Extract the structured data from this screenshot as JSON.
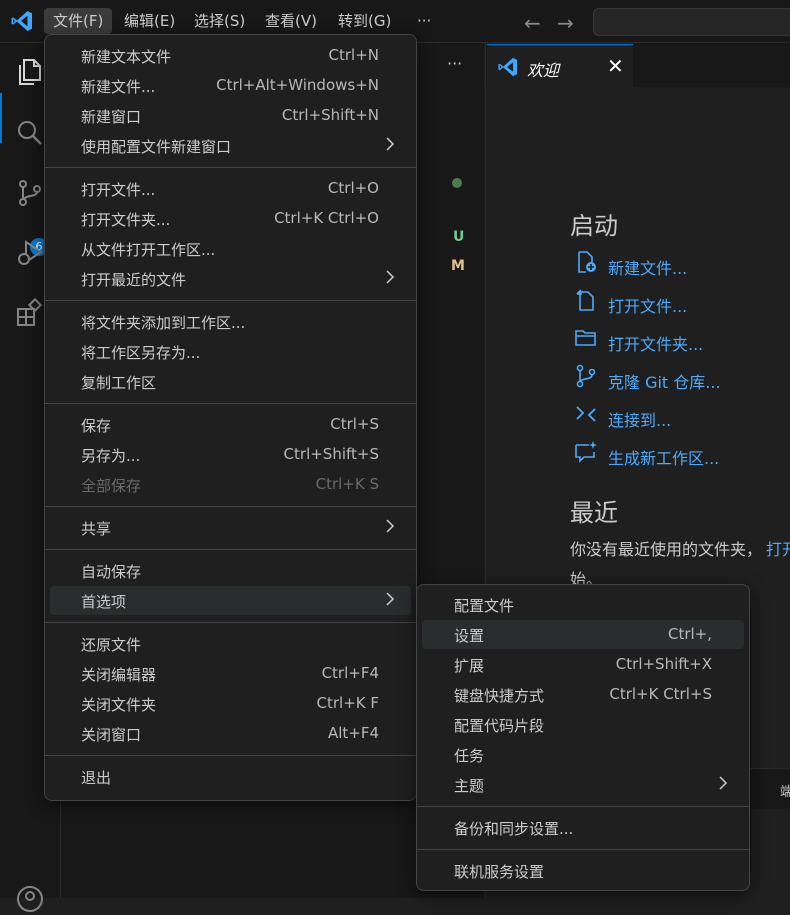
{
  "titlebar": {
    "menus": [
      "文件(F)",
      "编辑(E)",
      "选择(S)",
      "查看(V)",
      "转到(G)",
      "···"
    ],
    "back_arrow": "←",
    "forward_arrow": "→"
  },
  "activity_bar": {
    "icons": [
      "explorer-icon",
      "search-icon",
      "source-control-icon",
      "run-debug-icon",
      "extensions-icon",
      "account-icon"
    ],
    "scm_badge": "6"
  },
  "sidebar": {
    "more": "···",
    "status_u": "U",
    "status_m": "M"
  },
  "tab": {
    "label": "欢迎",
    "close": "✕"
  },
  "welcome": {
    "start_heading": "启动",
    "start_items": [
      {
        "label": "新建文件...",
        "icon": "new-file-icon"
      },
      {
        "label": "打开文件...",
        "icon": "open-file-icon"
      },
      {
        "label": "打开文件夹...",
        "icon": "folder-icon"
      },
      {
        "label": "克隆 Git 仓库...",
        "icon": "git-branch-icon"
      },
      {
        "label": "连接到...",
        "icon": "remote-icon"
      },
      {
        "label": "生成新工作区...",
        "icon": "chat-sparkle-icon"
      }
    ],
    "recent_heading": "最近",
    "recent_text_1": "你没有最近使用的文件夹，",
    "recent_link": "打开",
    "recent_text_2": "始。"
  },
  "panel": {
    "label": "端"
  },
  "file_menu": {
    "groups": [
      [
        {
          "label": "新建文本文件",
          "key": "Ctrl+N"
        },
        {
          "label": "新建文件...",
          "key": "Ctrl+Alt+Windows+N"
        },
        {
          "label": "新建窗口",
          "key": "Ctrl+Shift+N"
        },
        {
          "label": "使用配置文件新建窗口",
          "key": "",
          "submenu": true
        }
      ],
      [
        {
          "label": "打开文件...",
          "key": "Ctrl+O"
        },
        {
          "label": "打开文件夹...",
          "key": "Ctrl+K Ctrl+O"
        },
        {
          "label": "从文件打开工作区...",
          "key": ""
        },
        {
          "label": "打开最近的文件",
          "key": "",
          "submenu": true
        }
      ],
      [
        {
          "label": "将文件夹添加到工作区...",
          "key": ""
        },
        {
          "label": "将工作区另存为...",
          "key": ""
        },
        {
          "label": "复制工作区",
          "key": ""
        }
      ],
      [
        {
          "label": "保存",
          "key": "Ctrl+S"
        },
        {
          "label": "另存为...",
          "key": "Ctrl+Shift+S"
        },
        {
          "label": "全部保存",
          "key": "Ctrl+K S",
          "disabled": true
        }
      ],
      [
        {
          "label": "共享",
          "key": "",
          "submenu": true
        }
      ],
      [
        {
          "label": "自动保存",
          "key": ""
        },
        {
          "label": "首选项",
          "key": "",
          "submenu": true,
          "highlighted": true
        }
      ],
      [
        {
          "label": "还原文件",
          "key": ""
        },
        {
          "label": "关闭编辑器",
          "key": "Ctrl+F4"
        },
        {
          "label": "关闭文件夹",
          "key": "Ctrl+K F"
        },
        {
          "label": "关闭窗口",
          "key": "Alt+F4"
        }
      ],
      [
        {
          "label": "退出",
          "key": ""
        }
      ]
    ]
  },
  "prefs_menu": {
    "groups": [
      [
        {
          "label": "配置文件",
          "key": ""
        },
        {
          "label": "设置",
          "key": "Ctrl+,",
          "highlighted": true
        },
        {
          "label": "扩展",
          "key": "Ctrl+Shift+X"
        },
        {
          "label": "键盘快捷方式",
          "key": "Ctrl+K Ctrl+S"
        },
        {
          "label": "配置代码片段",
          "key": ""
        },
        {
          "label": "任务",
          "key": ""
        },
        {
          "label": "主题",
          "key": "",
          "submenu": true
        }
      ],
      [
        {
          "label": "备份和同步设置...",
          "key": ""
        }
      ],
      [
        {
          "label": "联机服务设置",
          "key": ""
        }
      ]
    ]
  },
  "colors": {
    "accent": "#0078d4",
    "link": "#4daafc",
    "menu_bg": "#1f1f1f",
    "highlight": "#2a2d2e"
  }
}
